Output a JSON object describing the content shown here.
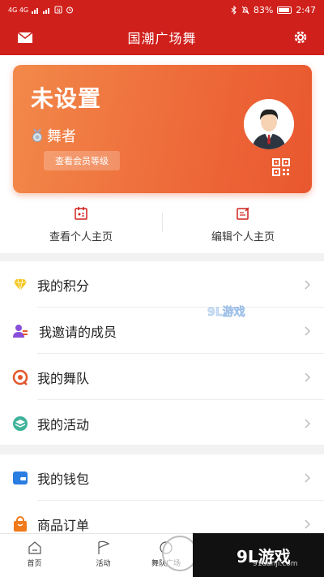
{
  "status_bar": {
    "left_text": "4G 4G",
    "battery": "83%",
    "time": "2:47"
  },
  "header": {
    "title": "国潮广场舞"
  },
  "profile": {
    "name": "未设置",
    "role": "舞者",
    "member_button": "查看会员等级"
  },
  "quick_actions": [
    {
      "label": "查看个人主页",
      "icon": "calendar-profile-icon"
    },
    {
      "label": "编辑个人主页",
      "icon": "edit-icon"
    }
  ],
  "menu_group_1": [
    {
      "label": "我的积分",
      "icon": "diamond-icon",
      "color": "#f5c518"
    },
    {
      "label": "我邀请的成员",
      "icon": "users-icon",
      "color": "#8a4fd8"
    },
    {
      "label": "我的舞队",
      "icon": "team-icon",
      "color": "#e2572c"
    },
    {
      "label": "我的活动",
      "icon": "layers-icon",
      "color": "#3fb39a"
    }
  ],
  "menu_group_2": [
    {
      "label": "我的钱包",
      "icon": "wallet-icon",
      "color": "#2a7de1"
    },
    {
      "label": "商品订单",
      "icon": "shopping-bag-icon",
      "color": "#f07a1a"
    }
  ],
  "tabs": [
    {
      "label": "首页",
      "icon": "home-icon"
    },
    {
      "label": "活动",
      "icon": "flag-icon"
    },
    {
      "label": "舞队广场",
      "icon": "plaza-icon"
    }
  ],
  "watermark": {
    "logo": "9L游戏",
    "site": "91danji.com"
  },
  "colors": {
    "brand_red": "#d0201c",
    "card_orange": "#ee6b3a"
  }
}
